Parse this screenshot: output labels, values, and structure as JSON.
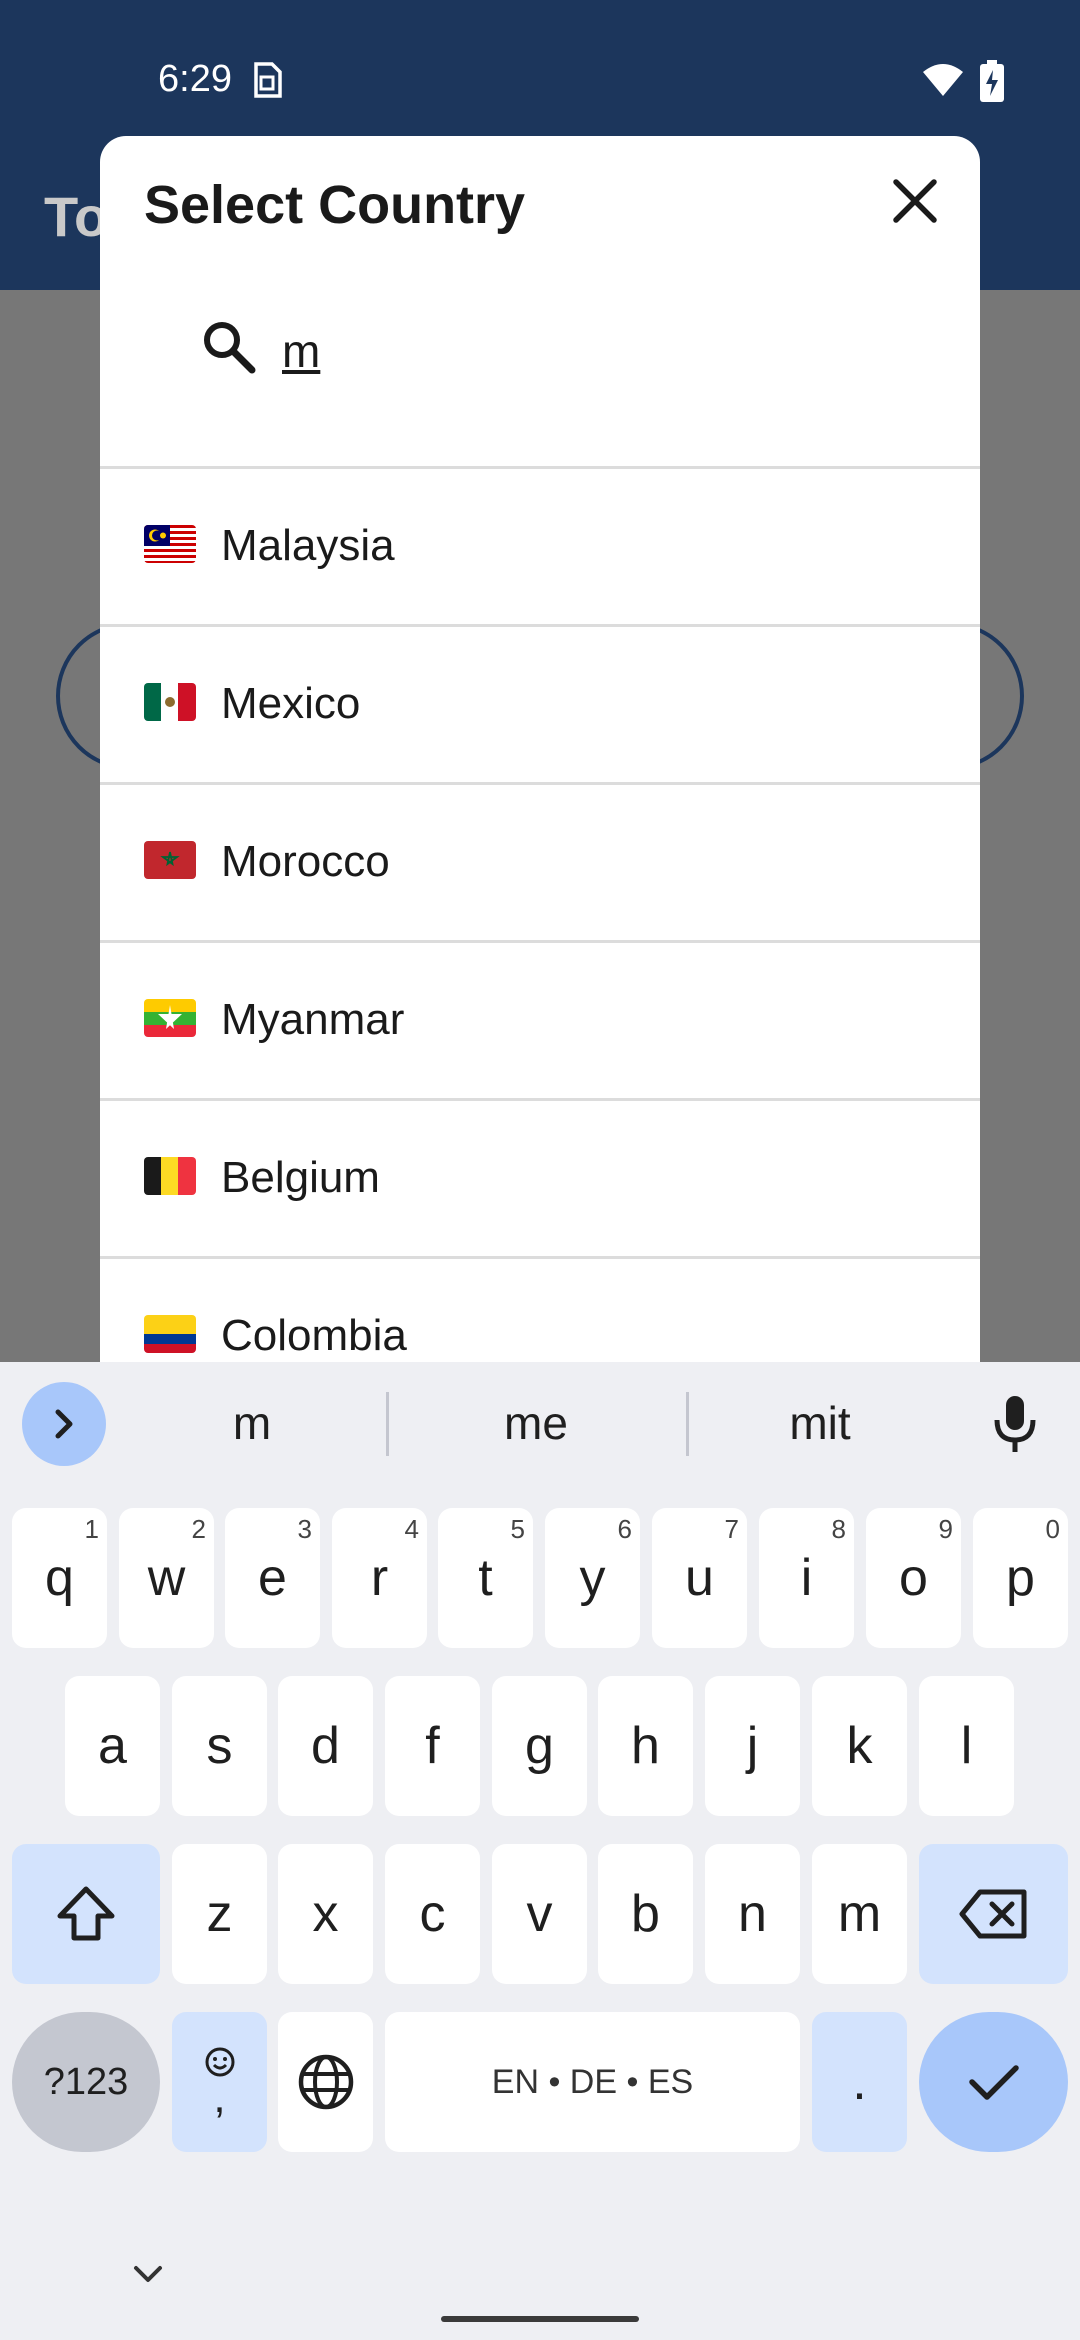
{
  "status_bar": {
    "time": "6:29"
  },
  "background": {
    "title_fragment": "To"
  },
  "dialog": {
    "title": "Select Country",
    "search": {
      "value": "m"
    },
    "countries": [
      {
        "name": "Malaysia",
        "flag": "malaysia-flag"
      },
      {
        "name": "Mexico",
        "flag": "mexico-flag"
      },
      {
        "name": "Morocco",
        "flag": "morocco-flag"
      },
      {
        "name": "Myanmar",
        "flag": "myanmar-flag"
      },
      {
        "name": "Belgium",
        "flag": "belgium-flag"
      },
      {
        "name": "Colombia",
        "flag": "colombia-flag"
      }
    ]
  },
  "keyboard": {
    "suggestions": [
      "m",
      "me",
      "mit"
    ],
    "row1": [
      {
        "key": "q",
        "hint": "1"
      },
      {
        "key": "w",
        "hint": "2"
      },
      {
        "key": "e",
        "hint": "3"
      },
      {
        "key": "r",
        "hint": "4"
      },
      {
        "key": "t",
        "hint": "5"
      },
      {
        "key": "y",
        "hint": "6"
      },
      {
        "key": "u",
        "hint": "7"
      },
      {
        "key": "i",
        "hint": "8"
      },
      {
        "key": "o",
        "hint": "9"
      },
      {
        "key": "p",
        "hint": "0"
      }
    ],
    "row2": [
      "a",
      "s",
      "d",
      "f",
      "g",
      "h",
      "j",
      "k",
      "l"
    ],
    "row3": [
      "z",
      "x",
      "c",
      "v",
      "b",
      "n",
      "m"
    ],
    "symbols_label": "?123",
    "emoji_comma_label": ",",
    "space_label": "EN • DE • ES",
    "period_label": "."
  },
  "colors": {
    "app_bar": "#1c365c",
    "scrim": "#777777",
    "keyboard_bg": "#eeeff3",
    "accent": "#a8c7fa",
    "special_key": "#d3e3fd"
  }
}
